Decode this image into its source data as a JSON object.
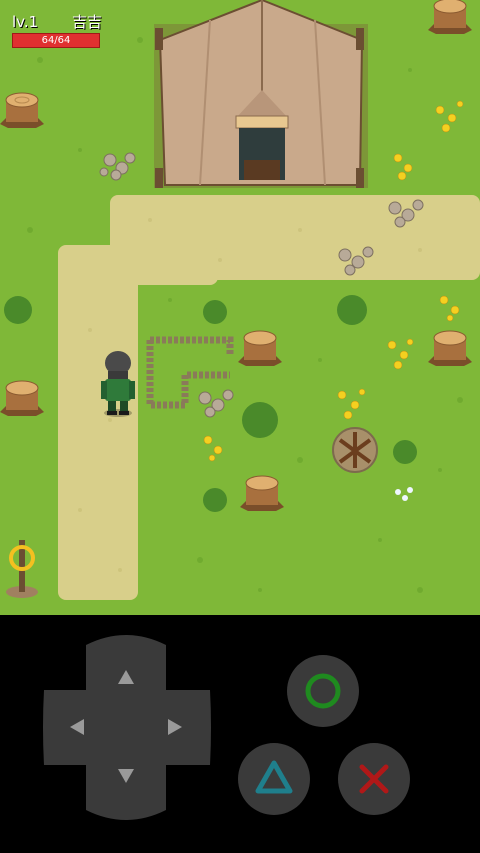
{
  "hud": {
    "level_label": "lv.1",
    "player_name": "吉吉",
    "hp_text": "64/64",
    "hp_fraction": 1.0,
    "hp_color": "#e03030"
  },
  "colors": {
    "grass": "#7fb838",
    "path": "#d8cf8a",
    "tent": "#c9a98b",
    "controls_bg": "#000000",
    "button_bg": "#3a3a3a",
    "circle_symbol": "#1f8a1f",
    "triangle_symbol": "#1f7f8c",
    "cross_symbol": "#b01818"
  },
  "controls": {
    "dpad_icon": "dpad-icon",
    "circle_icon": "circle-icon",
    "triangle_icon": "triangle-icon",
    "cross_icon": "cross-icon"
  }
}
